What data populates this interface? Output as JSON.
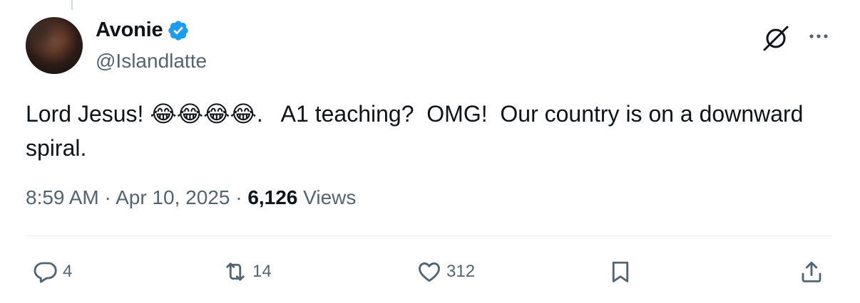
{
  "author": {
    "display_name": "Avonie",
    "handle": "@Islandlatte",
    "verified": true
  },
  "tweet": {
    "text": "Lord Jesus! 😂😂😂😂.   A1 teaching?  OMG!  Our country is on a downward spiral."
  },
  "meta": {
    "time": "8:59 AM",
    "date": "Apr 10, 2025",
    "sep1": " · ",
    "sep2": " · ",
    "views_count": "6,126",
    "views_label": "Views"
  },
  "actions": {
    "replies": "4",
    "reposts": "14",
    "likes": "312"
  },
  "icons": {
    "verified": "verified-badge-icon",
    "grok": "grok-icon",
    "more": "more-icon",
    "reply": "reply-icon",
    "repost": "repost-icon",
    "like": "heart-icon",
    "bookmark": "bookmark-icon",
    "share": "share-icon"
  },
  "colors": {
    "verified_blue": "#1d9bf0",
    "secondary_text": "#536471",
    "primary_text": "#0f1419"
  }
}
